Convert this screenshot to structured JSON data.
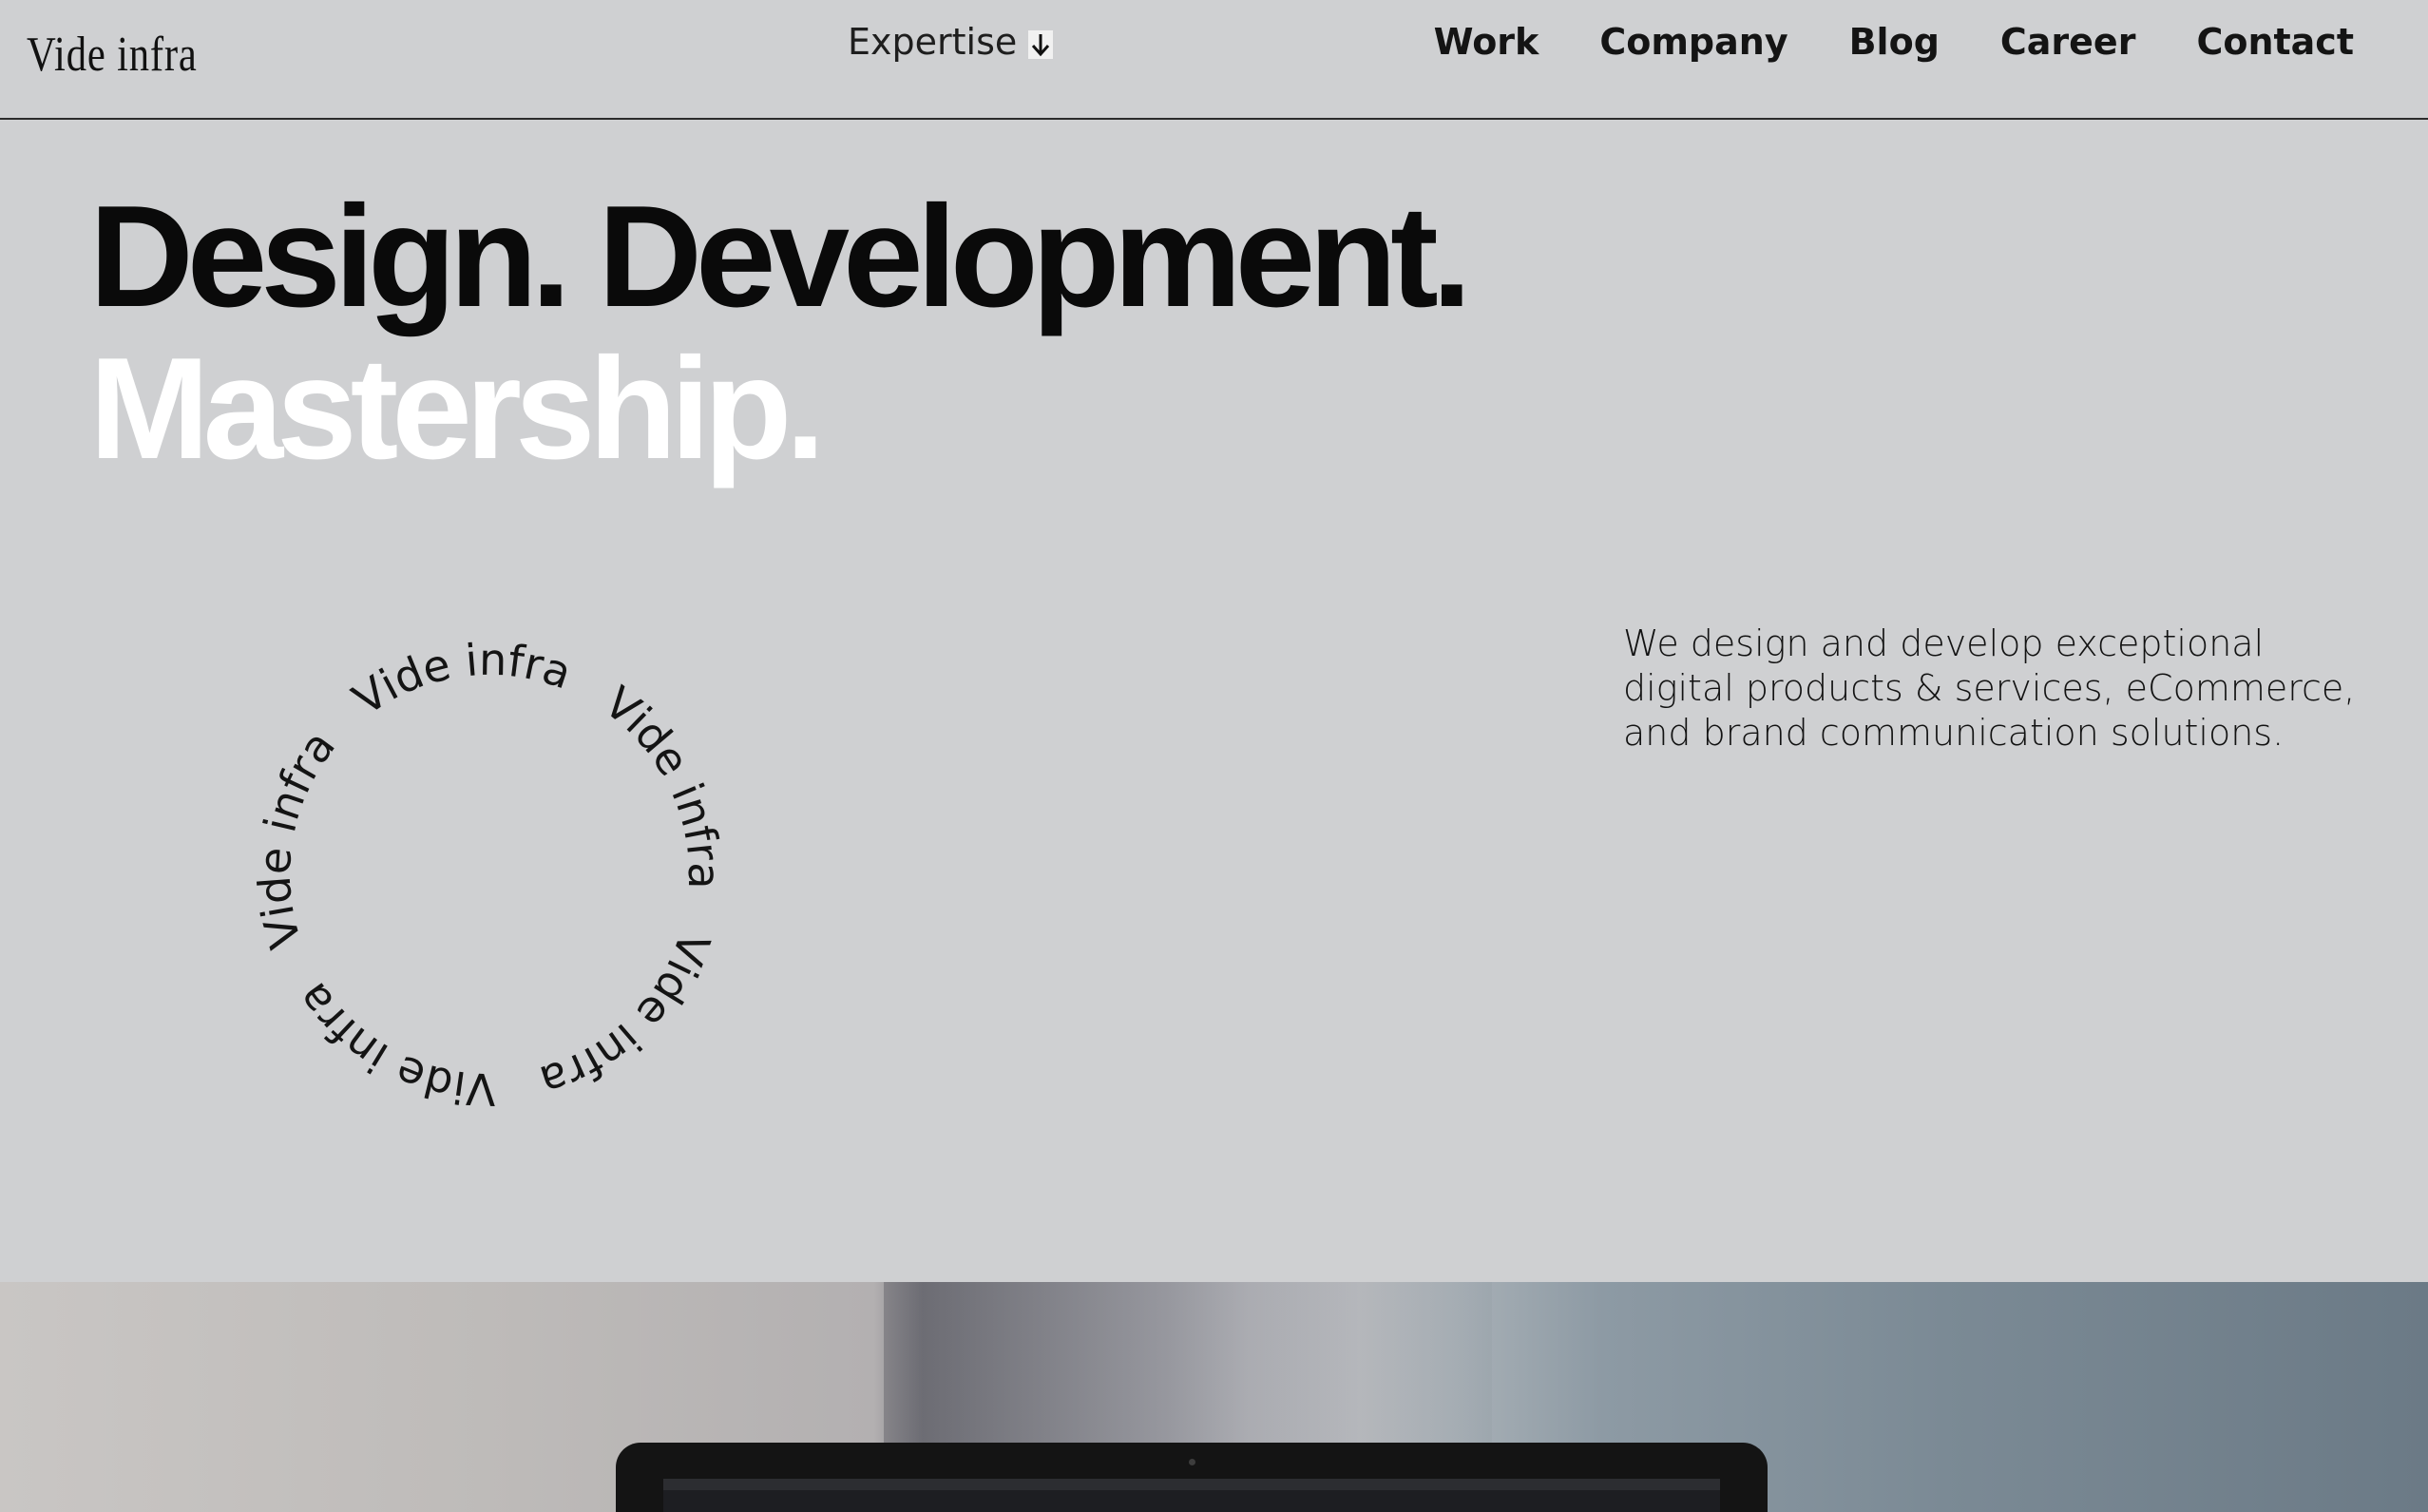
{
  "header": {
    "logo": "Vide infra",
    "expertise_label": "Expertise",
    "nav": [
      "Work",
      "Company",
      "Blog",
      "Career",
      "Contact"
    ]
  },
  "hero": {
    "line1": "Design. Development.",
    "line2": "Mastership.",
    "badge_text": "Vide infra",
    "intro": "We design and develop exceptional digital products & services, eCommerce, and brand communication solutions."
  },
  "colors": {
    "background": "#cfd0d2",
    "text": "#0b0b0b",
    "accent_text": "#ffffff"
  },
  "icons": {
    "expertise_toggle": "arrow-down-icon"
  }
}
